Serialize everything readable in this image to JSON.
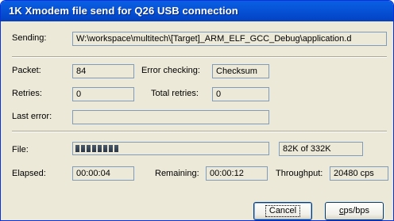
{
  "window": {
    "title": "1K Xmodem file send for Q26 USB connection"
  },
  "sending": {
    "label": "Sending:",
    "value": "W:\\workspace\\multitech\\[Target]_ARM_ELF_GCC_Debug\\application.d"
  },
  "packet": {
    "label": "Packet:",
    "value": "84"
  },
  "error_checking": {
    "label": "Error checking:",
    "value": "Checksum"
  },
  "retries": {
    "label": "Retries:",
    "value": "0"
  },
  "total_retries": {
    "label": "Total retries:",
    "value": "0"
  },
  "last_error": {
    "label": "Last error:",
    "value": ""
  },
  "file": {
    "label": "File:",
    "progress_fraction": 0.247,
    "size_text": "82K of 332K"
  },
  "elapsed": {
    "label": "Elapsed:",
    "value": "00:00:04"
  },
  "remaining": {
    "label": "Remaining:",
    "value": "00:00:12"
  },
  "throughput": {
    "label": "Throughput:",
    "value": "20480 cps"
  },
  "buttons": {
    "cancel": "Cancel",
    "cps_rest": "ps/bps",
    "cps_mnemonic": "c"
  },
  "colors": {
    "titlebar": "#0754d8",
    "window_bg": "#ece9d8",
    "progress_block": "#3b4757"
  }
}
